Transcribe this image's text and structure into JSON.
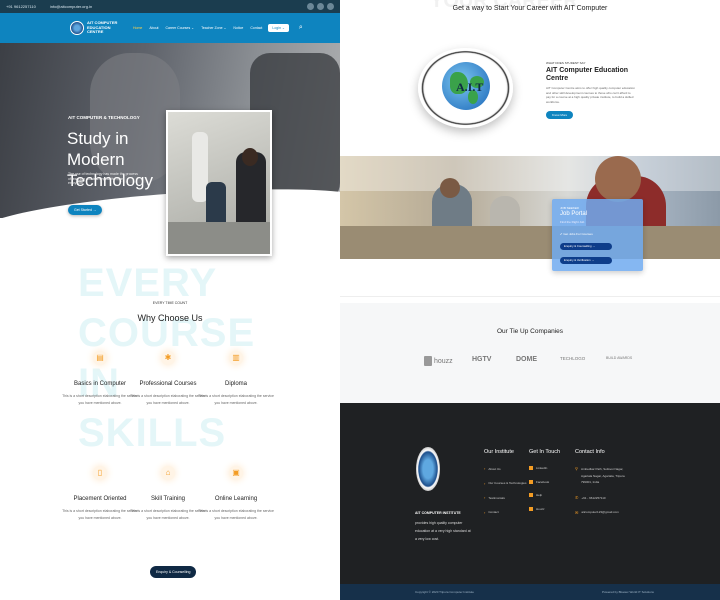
{
  "topbar": {
    "phone": "+91 9612257110",
    "email": "info@aitcomputer.org.in"
  },
  "nav": {
    "logo_text": "AIT COMPUTER EDUCATION CENTRE",
    "items": [
      {
        "label": "Home",
        "active": true
      },
      {
        "label": "About"
      },
      {
        "label": "Career Courses ⌄"
      },
      {
        "label": "Teacher Zone ⌄"
      },
      {
        "label": "Notice"
      },
      {
        "label": "Contact"
      }
    ],
    "login": "Login ⌄"
  },
  "hero": {
    "kicker": "AIT COMPUTER & TECHNOLOGY",
    "title": "Study in Modern Technology",
    "desc": "The use of technology has made the process of teaching and learning all the more enjoyable.",
    "button": "Get Started →"
  },
  "why": {
    "bg_text": "EVERY COURSE IN SKILLS",
    "kicker": "EVERY TIME COUNT",
    "title": "Why Choose Us",
    "services": [
      {
        "icon": "certificate-icon",
        "glyph": "▤",
        "name": "Basics in Computer",
        "desc": "This is a short description elaborating the service you have mentioned above."
      },
      {
        "icon": "gear-icon",
        "glyph": "✱",
        "name": "Professional Courses",
        "desc": "This is a short description elaborating the service you have mentioned above."
      },
      {
        "icon": "diploma-icon",
        "glyph": "▥",
        "name": "Diploma",
        "desc": "This is a short description elaborating the service you have mentioned above."
      },
      {
        "icon": "placement-icon",
        "glyph": "▯",
        "name": "Placement Oriented",
        "desc": "This is a short description elaborating the service you have mentioned above."
      },
      {
        "icon": "home-icon",
        "glyph": "⌂",
        "name": "Skill Training",
        "desc": "This is a short description elaborating the service you have mentioned above."
      },
      {
        "icon": "online-icon",
        "glyph": "▣",
        "name": "Online Learning",
        "desc": "This is a short description elaborating the service you have mentioned above."
      }
    ],
    "enquiry": "Enquiry & Counselling"
  },
  "career": {
    "ghost": "YOUR CAREER",
    "title": "Get a way to Start Your Career with AIT Computer",
    "logo_letters": "A.I.T",
    "kicker": "WHAT DOES STUDENT SAY",
    "about_title": "AIT Computer Education Centre",
    "about_desc": "AIT Computer Centre aims to offer high quality computer education and other skill development courses to those who can't afford to pay for a course at a high quality private institute, to build a skilled workforce.",
    "about_button": "Know More"
  },
  "job": {
    "kicker": "JOB SEEKER",
    "title": "Job Portal",
    "desc": "Find the Right Job",
    "check": "✔ Get Jobs For Courses",
    "btn1": "Enquiry & Counselling →",
    "btn2": "Enquiry & Verification →"
  },
  "tieup": {
    "title": "Our Tie Up Companies",
    "brands": [
      "houzz",
      "HGTV",
      "DOME",
      "TECHLOGO",
      "BUILD AWARDS"
    ]
  },
  "footer": {
    "brand": "AIT COMPUTER INSTITUTE",
    "desc": "provides high quality computer education at a very high standard at a very low cost.",
    "institute": {
      "title": "Our Institute",
      "items": [
        "About Us",
        "Our Courses & Technologies",
        "Testimonials",
        "Contact"
      ]
    },
    "touch": {
      "title": "Get In Touch",
      "items": [
        "LinkedIn",
        "Facebook",
        "Help",
        "Houzz"
      ]
    },
    "contact": {
      "title": "Contact Info",
      "address": "Ambedkar Path, Soilsvoi Nagar, Agartala Nagar, Agartala, Tripura 799001, India",
      "phone": "+91 - 9612257110",
      "email": "aitcomputer123@gmail.com"
    },
    "copyright": "Copyright © 2020 Tripura Computer Institute",
    "powered": "Powered by Bluetec World IT Solutions"
  }
}
